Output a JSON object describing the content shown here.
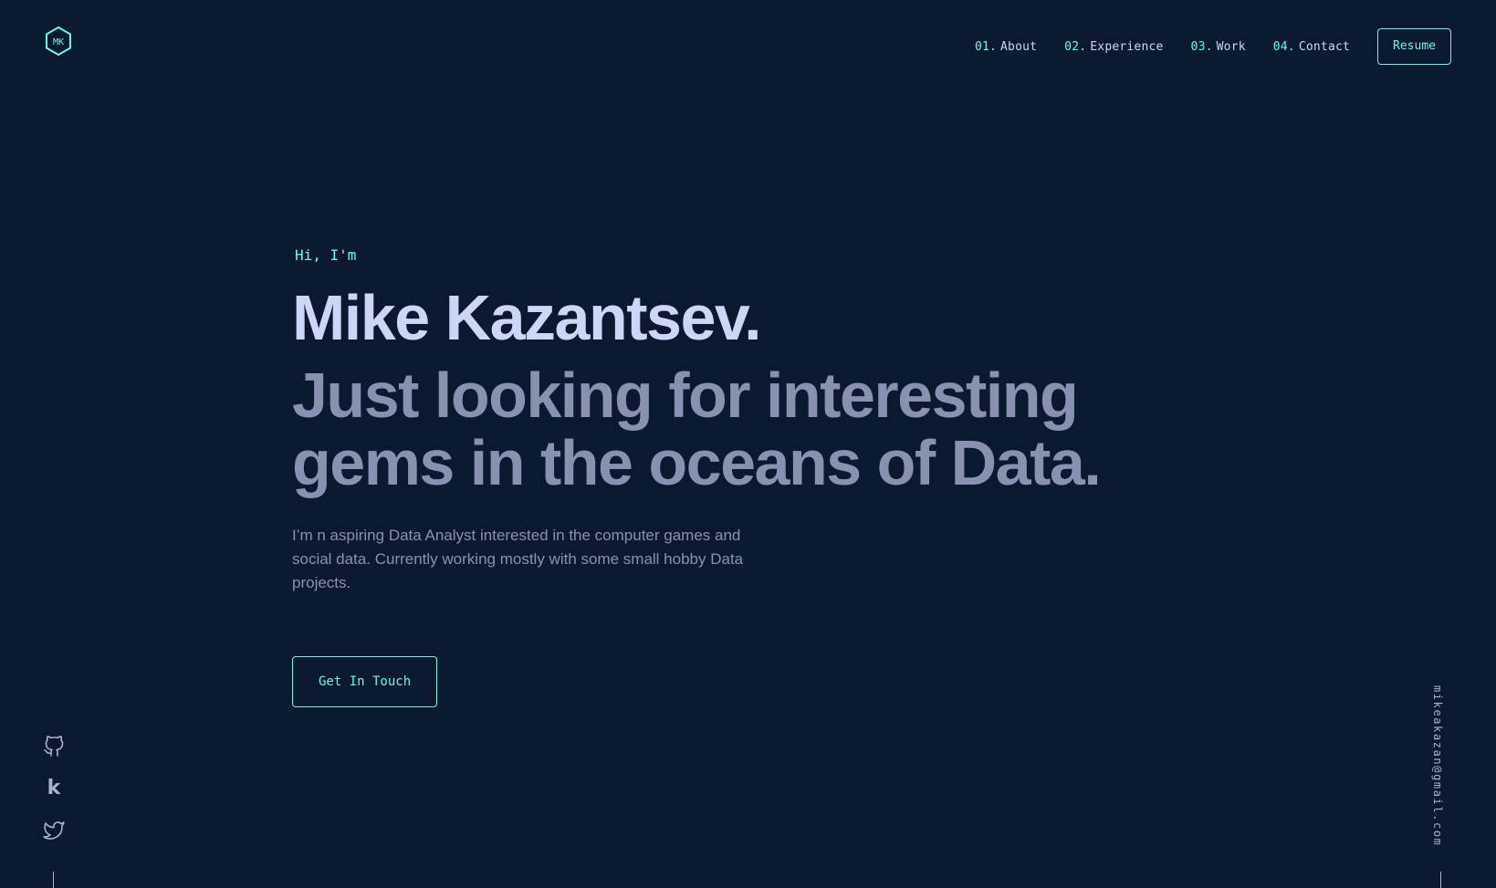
{
  "logo": {
    "text": "MK",
    "icon": "hexagon-logo-icon"
  },
  "nav": {
    "items": [
      {
        "num": "01.",
        "label": "About"
      },
      {
        "num": "02.",
        "label": "Experience"
      },
      {
        "num": "03.",
        "label": "Work"
      },
      {
        "num": "04.",
        "label": "Contact"
      }
    ],
    "resume_label": "Resume"
  },
  "hero": {
    "greeting": "Hi, I'm",
    "name": "Mike Kazantsev.",
    "tagline_line1": "Just looking for interesting",
    "tagline_line2": "gems in the oceans of Data.",
    "intro": "I’m n aspiring Data Analyst interested in the computer games and social data. Currently working mostly with some small hobby Data projects.",
    "cta_label": "Get In Touch"
  },
  "social": {
    "icons": [
      "github-icon",
      "kaggle-icon",
      "twitter-icon"
    ],
    "kaggle_glyph": "k"
  },
  "email": "mikeakazan@gmail.com",
  "colors": {
    "background": "#0b1930",
    "accent": "#64ffda",
    "heading": "#ccd6f6",
    "muted": "#8892b0"
  }
}
